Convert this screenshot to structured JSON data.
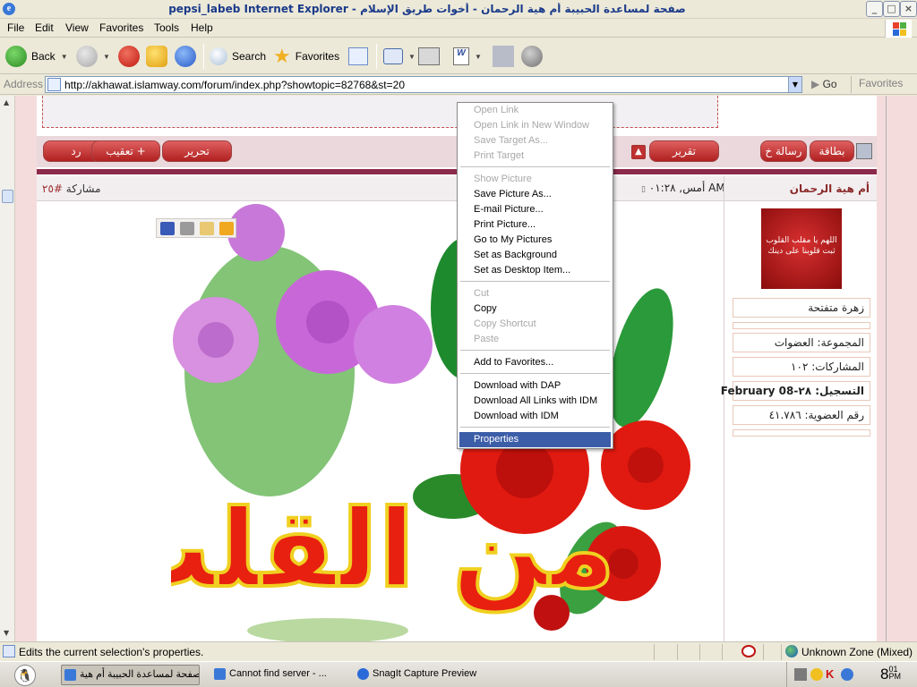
{
  "window": {
    "title": "pepsi_labeb Internet Explorer - صفحة لمساعدة الحبيبة أم هية الرحمان - أخوات طريق الإسلام",
    "min": "_",
    "max": "□",
    "close": "×"
  },
  "menu": [
    "File",
    "Edit",
    "View",
    "Favorites",
    "Tools",
    "Help"
  ],
  "toolbar": {
    "back": "Back",
    "search": "Search",
    "favorites": "Favorites",
    "dropdown": "▼"
  },
  "address": {
    "label": "Address",
    "url": "http://akhawat.islamway.com/forum/index.php?showtopic=82768&st=20",
    "go": "Go",
    "links": "Favorites"
  },
  "forum": {
    "buttons_left": [
      "رد",
      "تعقيب +",
      "تحرير"
    ],
    "button_report": "تقرير",
    "buttons_right": [
      "رسالة خ",
      "بطاقة"
    ],
    "post_number_label": "مشاركة",
    "post_number": "#٢٥",
    "post_time": "أمس, ٠١:٢٨ AM",
    "author": "أم هية الرحمان",
    "avatar_text": "اللهم يا مقلب القلوب ثبت قلوبنا على دينك",
    "user_title": "زهرة متفتحة",
    "group": "المجموعة: العضوات",
    "posts": "المشاركات: ١٠٢",
    "joined": "التسجيل: ٢٨-February 08",
    "member_no": "رقم العضوية: ٤١.٧٨٦",
    "image_text": "من القلب"
  },
  "context_menu": [
    {
      "label": "Open Link",
      "disabled": true
    },
    {
      "label": "Open Link in New Window",
      "disabled": true
    },
    {
      "label": "Save Target As...",
      "disabled": true
    },
    {
      "label": "Print Target",
      "disabled": true
    },
    {
      "sep": true
    },
    {
      "label": "Show Picture",
      "disabled": true
    },
    {
      "label": "Save Picture As...",
      "disabled": false
    },
    {
      "label": "E-mail Picture...",
      "disabled": false
    },
    {
      "label": "Print Picture...",
      "disabled": false
    },
    {
      "label": "Go to My Pictures",
      "disabled": false
    },
    {
      "label": "Set as Background",
      "disabled": false
    },
    {
      "label": "Set as Desktop Item...",
      "disabled": false
    },
    {
      "sep": true
    },
    {
      "label": "Cut",
      "disabled": true
    },
    {
      "label": "Copy",
      "disabled": false
    },
    {
      "label": "Copy Shortcut",
      "disabled": true
    },
    {
      "label": "Paste",
      "disabled": true
    },
    {
      "sep": true
    },
    {
      "label": "Add to Favorites...",
      "disabled": false
    },
    {
      "sep": true
    },
    {
      "label": "Download with DAP",
      "disabled": false
    },
    {
      "label": "Download All Links with IDM",
      "disabled": false
    },
    {
      "label": "Download with IDM",
      "disabled": false
    },
    {
      "sep": true
    },
    {
      "label": "Properties",
      "disabled": false,
      "selected": true
    }
  ],
  "status": {
    "text": "Edits the current selection's properties.",
    "zone": "Unknown Zone (Mixed)"
  },
  "taskbar": {
    "tasks": [
      "صفحة لمساعدة الحبيبة أم هية...",
      "Cannot find server - ...",
      "SnagIt Capture Preview"
    ],
    "clock_hour": "8",
    "clock_min": "01",
    "clock_ampm": "PM"
  }
}
